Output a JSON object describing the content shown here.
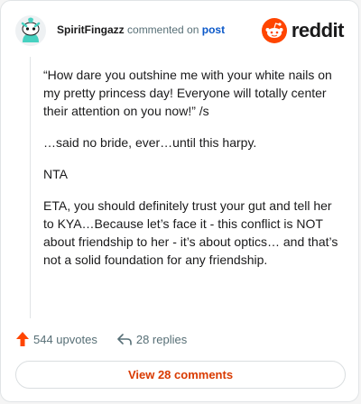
{
  "header": {
    "username": "SpiritFingazz",
    "action_text": "commented on",
    "post_link": "post",
    "brand": "reddit"
  },
  "comment": {
    "paragraphs": [
      "“How dare you outshine me with your white nails on my pretty princess day! Everyone will totally center their attention on you now!” /s",
      "…said no bride, ever…until this harpy.",
      "NTA",
      "ETA, you should definitely trust your gut and tell her to KYA…Because let’s face it - this conflict is NOT about friendship to her - it’s about optics… and that’s not a solid foundation for any friendship."
    ]
  },
  "actions": {
    "upvotes": "544 upvotes",
    "replies": "28 replies",
    "view_comments": "View 28 comments"
  },
  "colors": {
    "upvote": "#ff4500",
    "brand": "#ff4500",
    "link": "#0b58c9",
    "view_button_text": "#d93a00"
  },
  "icons": {
    "avatar": "snoo-avatar-icon",
    "logo": "reddit-logo-icon",
    "upvote": "upvote-arrow-icon",
    "reply": "reply-arrow-icon"
  }
}
